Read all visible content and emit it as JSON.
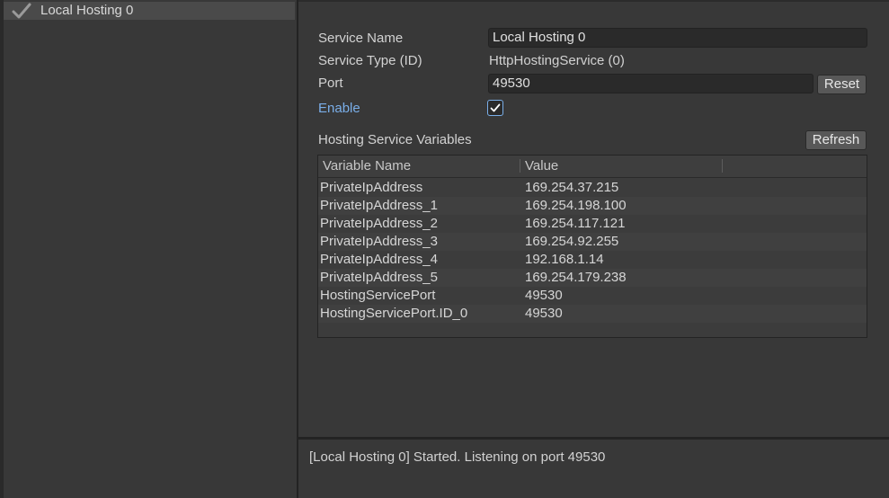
{
  "list": {
    "items": [
      {
        "label": "Local Hosting 0",
        "icon": "checkmark-icon",
        "selected": true
      }
    ]
  },
  "detail": {
    "service_name_label": "Service Name",
    "service_name_value": "Local Hosting 0",
    "service_type_label": "Service Type (ID)",
    "service_type_value": "HttpHostingService (0)",
    "port_label": "Port",
    "port_value": "49530",
    "reset_label": "Reset",
    "enable_label": "Enable",
    "enable_checked": true,
    "variables_title": "Hosting Service Variables",
    "refresh_label": "Refresh"
  },
  "table": {
    "columns": [
      "Variable Name",
      "Value"
    ],
    "rows": [
      [
        "PrivateIpAddress",
        "169.254.37.215"
      ],
      [
        "PrivateIpAddress_1",
        "169.254.198.100"
      ],
      [
        "PrivateIpAddress_2",
        "169.254.117.121"
      ],
      [
        "PrivateIpAddress_3",
        "169.254.92.255"
      ],
      [
        "PrivateIpAddress_4",
        "192.168.1.14"
      ],
      [
        "PrivateIpAddress_5",
        "169.254.179.238"
      ],
      [
        "HostingServicePort",
        "49530"
      ],
      [
        "HostingServicePort.ID_0",
        "49530"
      ]
    ]
  },
  "log": {
    "message": "[Local Hosting 0] Started. Listening on port 49530"
  },
  "colors": {
    "background": "#383838",
    "accent": "#7aaee8",
    "field_background": "#2a2a2a",
    "button_background": "#585858"
  }
}
